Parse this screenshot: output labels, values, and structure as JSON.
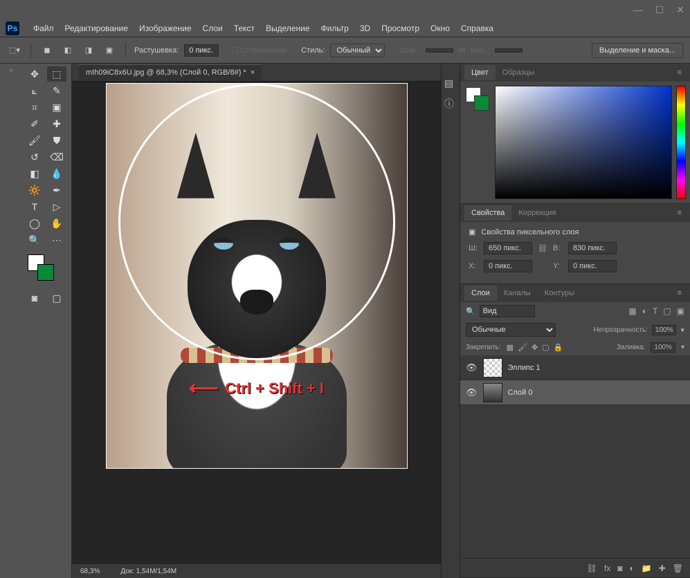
{
  "menu": {
    "file": "Файл",
    "edit": "Редактирование",
    "image": "Изображение",
    "layer": "Слои",
    "type": "Текст",
    "select": "Выделение",
    "filter": "Фильтр",
    "d3d": "3D",
    "view": "Просмотр",
    "window": "Окно",
    "help": "Справка"
  },
  "options": {
    "feather_label": "Растушевка:",
    "feather_value": "0 пикс.",
    "antialias": "Сглаживание",
    "style_label": "Стиль:",
    "style_value": "Обычный",
    "width_label": "Шир.:",
    "height_label": "Выс.:",
    "refine_btn": "Выделение и маска..."
  },
  "doc": {
    "tab": "mIh09iC8x6U.jpg @ 68,3% (Слой 0, RGB/8#) *",
    "zoom": "68,3%",
    "docsize": "Док: 1,54M/1,54M",
    "hotkey": "Ctrl + Shift + I"
  },
  "panels": {
    "color_tab": "Цвет",
    "swatches_tab": "Образцы",
    "props_tab": "Свойства",
    "adjust_tab": "Коррекция",
    "props_title": "Свойства пиксельного слоя",
    "w_label": "Ш:",
    "w_value": "650 пикс.",
    "h_label": "В:",
    "h_value": "830 пикс.",
    "x_label": "X:",
    "x_value": "0 пикс.",
    "y_label": "Y:",
    "y_value": "0 пикс.",
    "layers_tab": "Слои",
    "channels_tab": "Каналы",
    "paths_tab": "Контуры",
    "kind_label": "Вид",
    "blend_mode": "Обычные",
    "opacity_label": "Непрозрачность:",
    "opacity_value": "100%",
    "lock_label": "Закрепить:",
    "fill_label": "Заливка:",
    "fill_value": "100%",
    "layer1": "Эллипс 1",
    "layer2": "Слой 0"
  },
  "logo": "Ps"
}
